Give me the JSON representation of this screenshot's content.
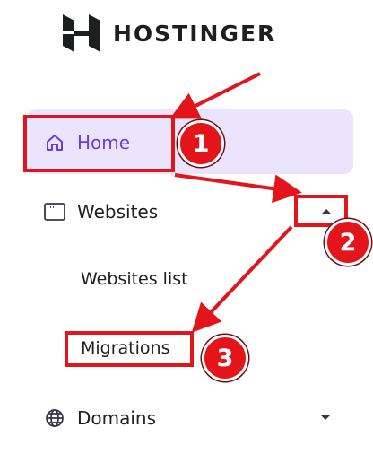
{
  "brand": {
    "name": "HOSTINGER",
    "logo_icon": "hostinger-logo"
  },
  "nav": {
    "home": {
      "label": "Home",
      "icon": "home-icon"
    },
    "websites": {
      "label": "Websites",
      "icon": "browser-window-icon",
      "chevron": "chevron-up-icon"
    },
    "websites_list": {
      "label": "Websites list"
    },
    "migrations": {
      "label": "Migrations"
    },
    "domains": {
      "label": "Domains",
      "icon": "globe-icon",
      "chevron": "chevron-down-icon"
    }
  },
  "annotations": {
    "badges": [
      "1",
      "2",
      "3"
    ],
    "color": "#e3151a"
  },
  "colors": {
    "accent": "#673de6",
    "active_bg": "#ebe4ff",
    "text": "#1d1e20"
  }
}
